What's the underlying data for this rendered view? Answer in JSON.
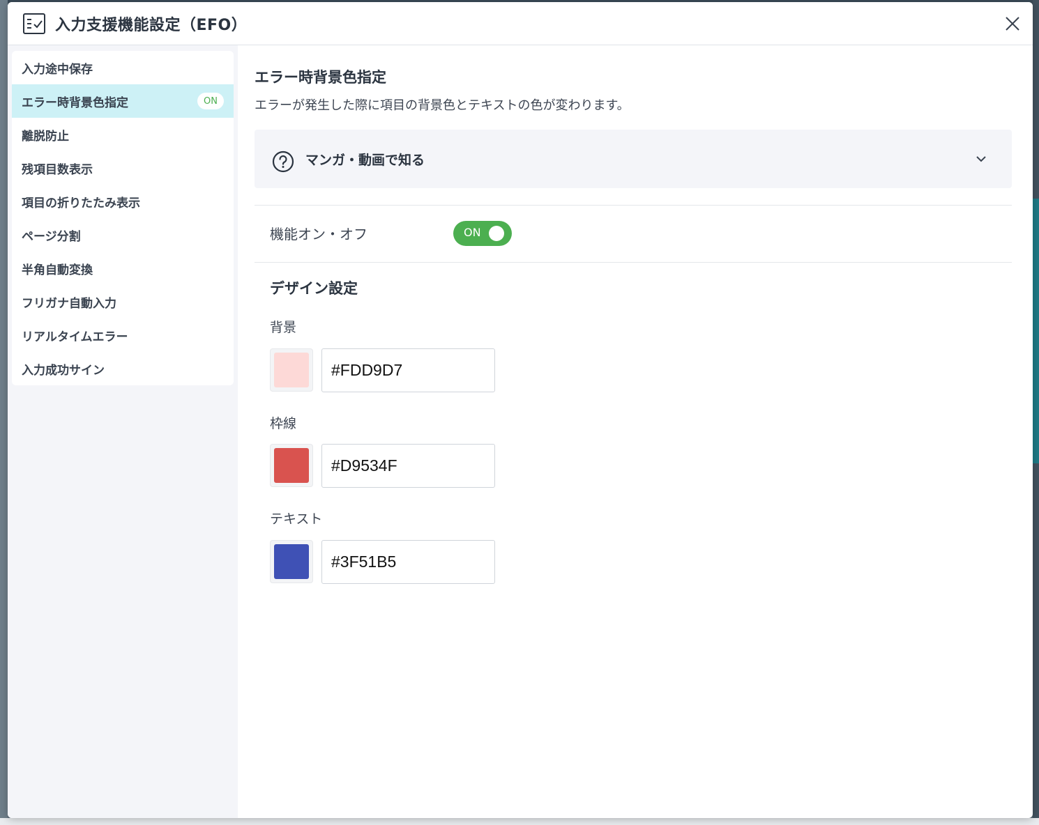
{
  "modal": {
    "title": "入力支援機能設定（EFO）"
  },
  "sidebar": {
    "items": [
      {
        "label": "入力途中保存",
        "badge": ""
      },
      {
        "label": "エラー時背景色指定",
        "badge": "ON",
        "active": true
      },
      {
        "label": "離脱防止",
        "badge": ""
      },
      {
        "label": "残項目数表示",
        "badge": ""
      },
      {
        "label": "項目の折りたたみ表示",
        "badge": ""
      },
      {
        "label": "ページ分割",
        "badge": ""
      },
      {
        "label": "半角自動変換",
        "badge": ""
      },
      {
        "label": "フリガナ自動入力",
        "badge": ""
      },
      {
        "label": "リアルタイムエラー",
        "badge": ""
      },
      {
        "label": "入力成功サイン",
        "badge": ""
      }
    ]
  },
  "main": {
    "title": "エラー時背景色指定",
    "description": "エラーが発生した際に項目の背景色とテキストの色が変わります。",
    "accordion_label": "マンガ・動画で知る",
    "toggle_label": "機能オン・オフ",
    "toggle_state": "ON",
    "design_title": "デザイン設定",
    "fields": [
      {
        "label": "背景",
        "value": "#FDD9D7",
        "color": "#FDD9D7"
      },
      {
        "label": "枠線",
        "value": "#D9534F",
        "color": "#D9534F"
      },
      {
        "label": "テキスト",
        "value": "#3F51B5",
        "color": "#3F51B5"
      }
    ]
  },
  "colors": {
    "accent_on": "#4CAF50",
    "active_item_bg": "#CDF1F6"
  },
  "icons": {
    "header": "checklist-icon",
    "close": "close-icon",
    "help": "question-circle-icon",
    "expand": "chevron-down-icon"
  }
}
